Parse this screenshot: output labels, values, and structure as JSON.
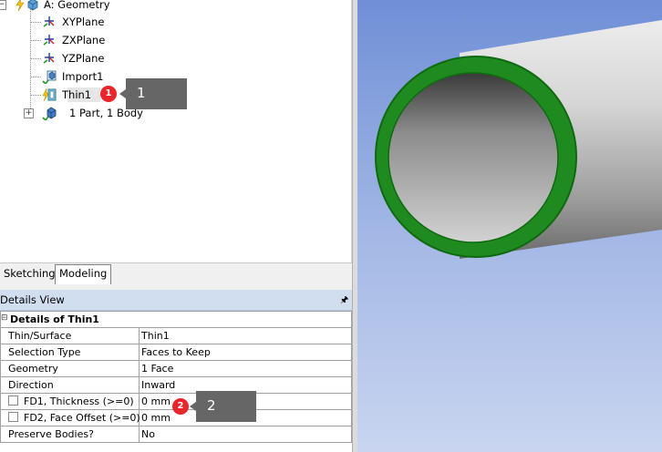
{
  "tree": {
    "root_label": "A: Geometry",
    "items": [
      {
        "label": "XYPlane"
      },
      {
        "label": "ZXPlane"
      },
      {
        "label": "YZPlane"
      },
      {
        "label": "Import1"
      },
      {
        "label": "Thin1"
      },
      {
        "label": "1 Part, 1 Body"
      }
    ]
  },
  "callouts": [
    {
      "badge": "1",
      "text": "1"
    },
    {
      "badge": "2",
      "text": "2"
    }
  ],
  "tabs": [
    {
      "label": "Sketching"
    },
    {
      "label": "Modeling"
    }
  ],
  "details": {
    "title": "Details View",
    "group_label": "Details of Thin1",
    "rows": [
      {
        "name": "Thin/Surface",
        "value": "Thin1"
      },
      {
        "name": "Selection Type",
        "value": "Faces to Keep"
      },
      {
        "name": "Geometry",
        "value": "1 Face"
      },
      {
        "name": "Direction",
        "value": "Inward"
      },
      {
        "name": "FD1,  Thickness (>=0)",
        "value": "0 mm"
      },
      {
        "name": "FD2,  Face Offset (>=0)",
        "value": "0 mm"
      },
      {
        "name": "Preserve Bodies?",
        "value": "No"
      }
    ]
  },
  "colors": {
    "ring": "#1f8a1f",
    "viewport_top": "#6f8fd6",
    "viewport_bottom": "#c9d5f0",
    "badge": "#e8262b",
    "callout": "#666666"
  },
  "icons": {
    "plane": "axis-plane-icon",
    "import": "import-cube-icon",
    "thin": "thin-feature-icon",
    "body": "solid-body-icon",
    "pin": "pin-icon"
  }
}
